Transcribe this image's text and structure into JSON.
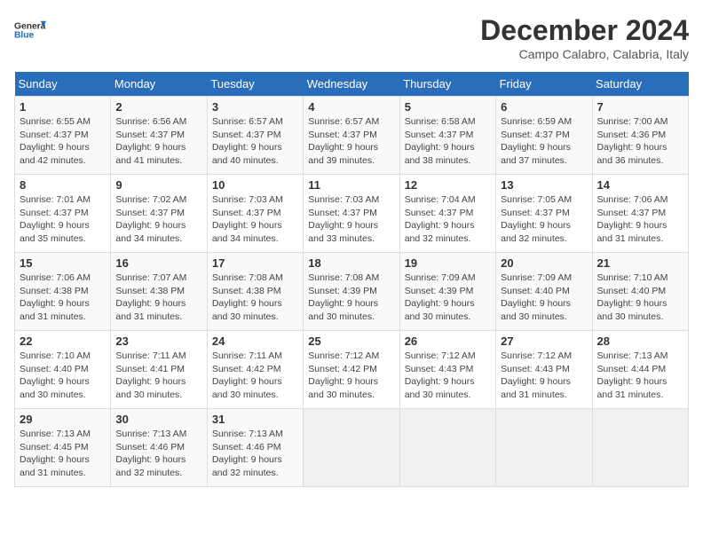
{
  "logo": {
    "line1": "General",
    "line2": "Blue"
  },
  "title": "December 2024",
  "subtitle": "Campo Calabro, Calabria, Italy",
  "days_of_week": [
    "Sunday",
    "Monday",
    "Tuesday",
    "Wednesday",
    "Thursday",
    "Friday",
    "Saturday"
  ],
  "weeks": [
    [
      {
        "day": "1",
        "info": "Sunrise: 6:55 AM\nSunset: 4:37 PM\nDaylight: 9 hours\nand 42 minutes."
      },
      {
        "day": "2",
        "info": "Sunrise: 6:56 AM\nSunset: 4:37 PM\nDaylight: 9 hours\nand 41 minutes."
      },
      {
        "day": "3",
        "info": "Sunrise: 6:57 AM\nSunset: 4:37 PM\nDaylight: 9 hours\nand 40 minutes."
      },
      {
        "day": "4",
        "info": "Sunrise: 6:57 AM\nSunset: 4:37 PM\nDaylight: 9 hours\nand 39 minutes."
      },
      {
        "day": "5",
        "info": "Sunrise: 6:58 AM\nSunset: 4:37 PM\nDaylight: 9 hours\nand 38 minutes."
      },
      {
        "day": "6",
        "info": "Sunrise: 6:59 AM\nSunset: 4:37 PM\nDaylight: 9 hours\nand 37 minutes."
      },
      {
        "day": "7",
        "info": "Sunrise: 7:00 AM\nSunset: 4:36 PM\nDaylight: 9 hours\nand 36 minutes."
      }
    ],
    [
      {
        "day": "8",
        "info": "Sunrise: 7:01 AM\nSunset: 4:37 PM\nDaylight: 9 hours\nand 35 minutes."
      },
      {
        "day": "9",
        "info": "Sunrise: 7:02 AM\nSunset: 4:37 PM\nDaylight: 9 hours\nand 34 minutes."
      },
      {
        "day": "10",
        "info": "Sunrise: 7:03 AM\nSunset: 4:37 PM\nDaylight: 9 hours\nand 34 minutes."
      },
      {
        "day": "11",
        "info": "Sunrise: 7:03 AM\nSunset: 4:37 PM\nDaylight: 9 hours\nand 33 minutes."
      },
      {
        "day": "12",
        "info": "Sunrise: 7:04 AM\nSunset: 4:37 PM\nDaylight: 9 hours\nand 32 minutes."
      },
      {
        "day": "13",
        "info": "Sunrise: 7:05 AM\nSunset: 4:37 PM\nDaylight: 9 hours\nand 32 minutes."
      },
      {
        "day": "14",
        "info": "Sunrise: 7:06 AM\nSunset: 4:37 PM\nDaylight: 9 hours\nand 31 minutes."
      }
    ],
    [
      {
        "day": "15",
        "info": "Sunrise: 7:06 AM\nSunset: 4:38 PM\nDaylight: 9 hours\nand 31 minutes."
      },
      {
        "day": "16",
        "info": "Sunrise: 7:07 AM\nSunset: 4:38 PM\nDaylight: 9 hours\nand 31 minutes."
      },
      {
        "day": "17",
        "info": "Sunrise: 7:08 AM\nSunset: 4:38 PM\nDaylight: 9 hours\nand 30 minutes."
      },
      {
        "day": "18",
        "info": "Sunrise: 7:08 AM\nSunset: 4:39 PM\nDaylight: 9 hours\nand 30 minutes."
      },
      {
        "day": "19",
        "info": "Sunrise: 7:09 AM\nSunset: 4:39 PM\nDaylight: 9 hours\nand 30 minutes."
      },
      {
        "day": "20",
        "info": "Sunrise: 7:09 AM\nSunset: 4:40 PM\nDaylight: 9 hours\nand 30 minutes."
      },
      {
        "day": "21",
        "info": "Sunrise: 7:10 AM\nSunset: 4:40 PM\nDaylight: 9 hours\nand 30 minutes."
      }
    ],
    [
      {
        "day": "22",
        "info": "Sunrise: 7:10 AM\nSunset: 4:40 PM\nDaylight: 9 hours\nand 30 minutes."
      },
      {
        "day": "23",
        "info": "Sunrise: 7:11 AM\nSunset: 4:41 PM\nDaylight: 9 hours\nand 30 minutes."
      },
      {
        "day": "24",
        "info": "Sunrise: 7:11 AM\nSunset: 4:42 PM\nDaylight: 9 hours\nand 30 minutes."
      },
      {
        "day": "25",
        "info": "Sunrise: 7:12 AM\nSunset: 4:42 PM\nDaylight: 9 hours\nand 30 minutes."
      },
      {
        "day": "26",
        "info": "Sunrise: 7:12 AM\nSunset: 4:43 PM\nDaylight: 9 hours\nand 30 minutes."
      },
      {
        "day": "27",
        "info": "Sunrise: 7:12 AM\nSunset: 4:43 PM\nDaylight: 9 hours\nand 31 minutes."
      },
      {
        "day": "28",
        "info": "Sunrise: 7:13 AM\nSunset: 4:44 PM\nDaylight: 9 hours\nand 31 minutes."
      }
    ],
    [
      {
        "day": "29",
        "info": "Sunrise: 7:13 AM\nSunset: 4:45 PM\nDaylight: 9 hours\nand 31 minutes."
      },
      {
        "day": "30",
        "info": "Sunrise: 7:13 AM\nSunset: 4:46 PM\nDaylight: 9 hours\nand 32 minutes."
      },
      {
        "day": "31",
        "info": "Sunrise: 7:13 AM\nSunset: 4:46 PM\nDaylight: 9 hours\nand 32 minutes."
      },
      {
        "day": "",
        "info": ""
      },
      {
        "day": "",
        "info": ""
      },
      {
        "day": "",
        "info": ""
      },
      {
        "day": "",
        "info": ""
      }
    ]
  ]
}
